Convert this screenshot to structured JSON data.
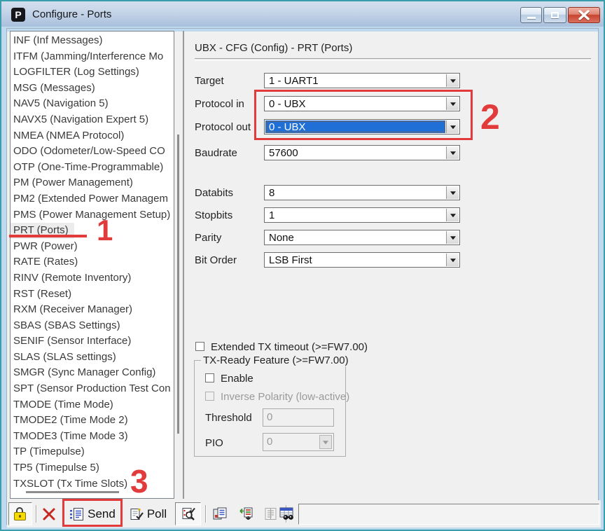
{
  "window": {
    "title": "Configure - Ports",
    "icon_letter": "P",
    "controls": [
      "minimize",
      "maximize",
      "close"
    ]
  },
  "sidebar": {
    "items": [
      "INF (Inf Messages)",
      "ITFM (Jamming/Interference Mo",
      "LOGFILTER (Log Settings)",
      "MSG (Messages)",
      "NAV5 (Navigation 5)",
      "NAVX5 (Navigation Expert 5)",
      "NMEA (NMEA Protocol)",
      "ODO (Odometer/Low-Speed CO",
      "OTP (One-Time-Programmable)",
      "PM (Power Management)",
      "PM2 (Extended Power Managem",
      "PMS (Power Management Setup)",
      "PRT (Ports)",
      "PWR (Power)",
      "RATE (Rates)",
      "RINV (Remote Inventory)",
      "RST (Reset)",
      "RXM (Receiver Manager)",
      "SBAS (SBAS Settings)",
      "SENIF (Sensor Interface)",
      "SLAS (SLAS settings)",
      "SMGR (Sync Manager Config)",
      "SPT (Sensor Production Test Con",
      "TMODE (Time Mode)",
      "TMODE2 (Time Mode 2)",
      "TMODE3 (Time Mode 3)",
      "TP (Timepulse)",
      "TP5 (Timepulse 5)",
      "TXSLOT (Tx Time Slots)"
    ],
    "selected_item": "PRT (Ports)",
    "selected_index": 12
  },
  "panel": {
    "header": "UBX - CFG (Config) - PRT (Ports)",
    "fields": [
      {
        "label": "Target",
        "value": "1 - UART1",
        "highlighted": false
      },
      {
        "label": "Protocol in",
        "value": "0 - UBX",
        "highlighted": false
      },
      {
        "label": "Protocol out",
        "value": "0 - UBX",
        "highlighted": true
      },
      {
        "label": "Baudrate",
        "value": "57600",
        "highlighted": false
      },
      {
        "label": "Databits",
        "value": "8",
        "highlighted": false
      },
      {
        "label": "Stopbits",
        "value": "1",
        "highlighted": false
      },
      {
        "label": "Parity",
        "value": "None",
        "highlighted": false
      },
      {
        "label": "Bit Order",
        "value": "LSB First",
        "highlighted": false
      }
    ],
    "extended_tx": {
      "label": "Extended TX timeout (>=FW7.00)",
      "checked": false
    },
    "tx_ready": {
      "title": "TX-Ready Feature (>=FW7.00)",
      "enable": {
        "label": "Enable",
        "checked": false
      },
      "inverse": {
        "label": "Inverse Polarity (low-active)",
        "checked": false,
        "disabled": true
      },
      "threshold": {
        "label": "Threshold",
        "value": "0",
        "disabled": true
      },
      "pio": {
        "label": "PIO",
        "value": "0",
        "disabled": true
      }
    }
  },
  "toolbar": {
    "send_label": "Send",
    "poll_label": "Poll",
    "status_value": "",
    "icons": [
      "lock-icon",
      "delete-icon",
      "send-icon",
      "poll-icon",
      "auto-poll-icon",
      "copy-messages-icon",
      "transfer-messages-icon",
      "message-list-icon",
      "table-search-icon"
    ]
  },
  "annotations": {
    "step1": "1",
    "step2": "2",
    "step3": "3",
    "red": "#e23b3b"
  },
  "colors": {
    "selection_blue": "#1f6fd6",
    "frame_teal": "#3a9dab",
    "frame_band": "#bfdaee",
    "titlebar_top": "#d4dfef",
    "titlebar_bottom": "#a6bedb",
    "panel_bg": "#f0f0f0"
  }
}
